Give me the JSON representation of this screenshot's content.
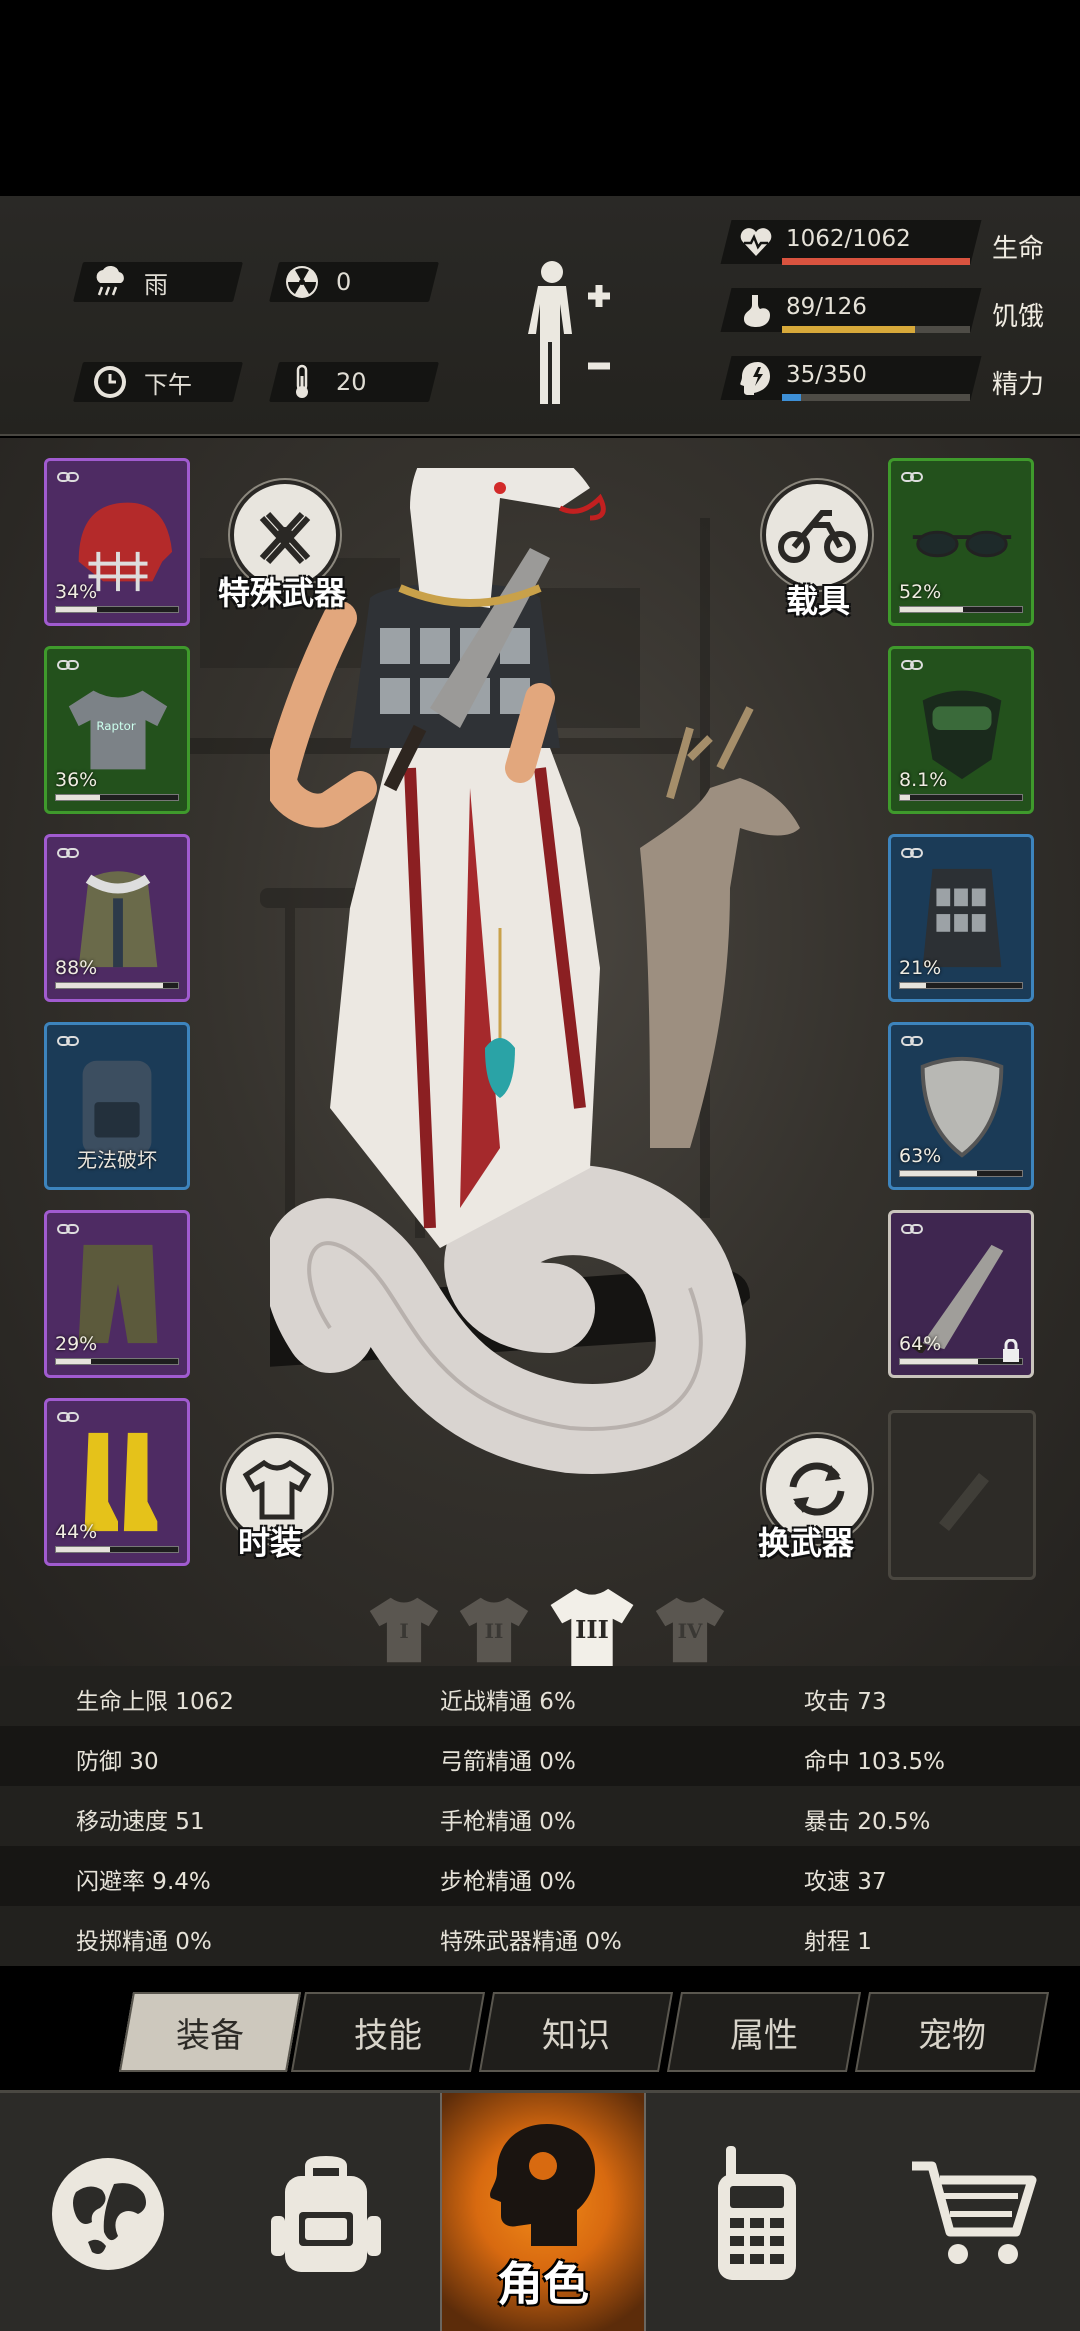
{
  "hud": {
    "weather": {
      "icon": "rain-cloud-icon",
      "label": "雨"
    },
    "radiation": {
      "icon": "radiation-icon",
      "value": "0"
    },
    "time": {
      "icon": "clock-icon",
      "label": "下午"
    },
    "temperature": {
      "icon": "thermometer-icon",
      "value": "20"
    },
    "health": {
      "icon": "heart-pulse-icon",
      "text": "1062/1062",
      "label": "生命",
      "fill": 1.0,
      "color": "#d9533f"
    },
    "hunger": {
      "icon": "stomach-icon",
      "text": "89/126",
      "label": "饥饿",
      "fill": 0.706,
      "color": "#d7a93a"
    },
    "energy": {
      "icon": "energy-head-icon",
      "text": "35/350",
      "label": "精力",
      "fill": 0.1,
      "color": "#3d8fd6"
    }
  },
  "equipment": {
    "left": [
      {
        "name": "helmet",
        "rarity": "purple",
        "pct": "34%",
        "dur": 0.34
      },
      {
        "name": "tshirt",
        "rarity": "green",
        "pct": "36%",
        "dur": 0.36
      },
      {
        "name": "parka",
        "rarity": "purple",
        "pct": "88%",
        "dur": 0.88
      },
      {
        "name": "backpack",
        "rarity": "blue",
        "text": "无法破坏"
      },
      {
        "name": "pants",
        "rarity": "purple",
        "pct": "29%",
        "dur": 0.29
      },
      {
        "name": "boots",
        "rarity": "purple",
        "pct": "44%",
        "dur": 0.44
      }
    ],
    "right": [
      {
        "name": "glasses",
        "rarity": "green",
        "pct": "52%",
        "dur": 0.52
      },
      {
        "name": "gas-mask",
        "rarity": "green",
        "pct": "8.1%",
        "dur": 0.081
      },
      {
        "name": "vest",
        "rarity": "blue",
        "pct": "21%",
        "dur": 0.21
      },
      {
        "name": "shield",
        "rarity": "blue",
        "pct": "63%",
        "dur": 0.63
      },
      {
        "name": "machete",
        "rarity": "locked-purple",
        "pct": "64%",
        "dur": 0.64
      }
    ]
  },
  "buttons": {
    "special_weapon": "特殊武器",
    "vehicle": "载具",
    "fashion": "时装",
    "swap_weapon": "换武器"
  },
  "outfit_slots": [
    "I",
    "II",
    "III",
    "IV"
  ],
  "stats": [
    [
      "生命上限 1062",
      "近战精通 6%",
      "攻击 73"
    ],
    [
      "防御 30",
      "弓箭精通 0%",
      "命中 103.5%"
    ],
    [
      "移动速度 51",
      "手枪精通 0%",
      "暴击 20.5%"
    ],
    [
      "闪避率 9.4%",
      "步枪精通 0%",
      "攻速 37"
    ],
    [
      "投掷精通 0%",
      "特殊武器精通 0%",
      "射程 1"
    ]
  ],
  "tabs": [
    "装备",
    "技能",
    "知识",
    "属性",
    "宠物"
  ],
  "nav": {
    "world": "globe-icon",
    "inventory": "backpack-icon",
    "character_label": "角色",
    "radio": "walkie-talkie-icon",
    "shop": "shopping-cart-icon"
  }
}
